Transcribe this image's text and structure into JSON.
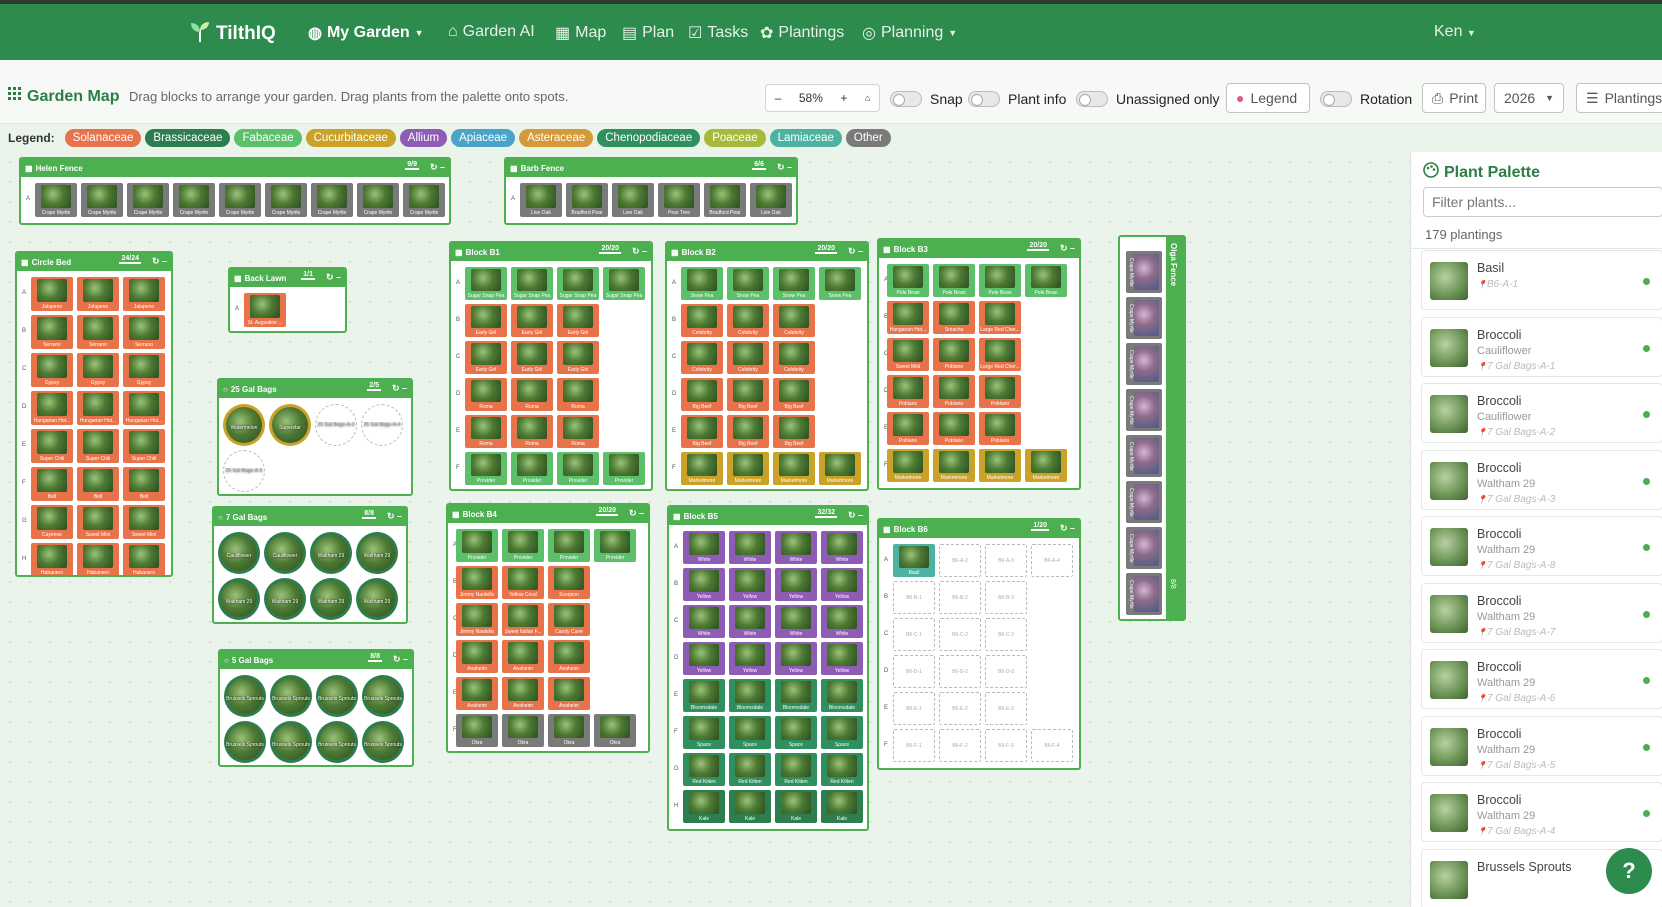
{
  "app": {
    "brand": "TilthIQ",
    "brand_icon": "sprout-icon"
  },
  "nav": {
    "items": [
      {
        "label": "My Garden",
        "icon": "globe-icon",
        "dropdown": true
      },
      {
        "label": "Garden AI",
        "icon": "robot-icon"
      },
      {
        "label": "Map",
        "icon": "map-icon"
      },
      {
        "label": "Plan",
        "icon": "plan-icon"
      },
      {
        "label": "Tasks",
        "icon": "check-icon"
      },
      {
        "label": "Plantings",
        "icon": "flower-icon"
      },
      {
        "label": "Planning",
        "icon": "compass-icon",
        "dropdown": true
      }
    ],
    "user": "Ken"
  },
  "toolbar": {
    "title": "Garden Map",
    "description": "Drag blocks to arrange your garden. Drag plants from the palette onto spots.",
    "zoom": "58%",
    "toggles": [
      {
        "label": "Snap",
        "on": false
      },
      {
        "label": "Plant info",
        "on": false
      },
      {
        "label": "Unassigned only",
        "on": false
      }
    ],
    "legend_button": "Legend",
    "rotation_label": "Rotation",
    "print_button": "Print",
    "year": "2026",
    "plantings_button": "Plantings"
  },
  "legend": {
    "label": "Legend:",
    "families": [
      {
        "name": "Solanaceae",
        "color": "#e8734a"
      },
      {
        "name": "Brassicaceae",
        "color": "#2e7d4f"
      },
      {
        "name": "Fabaceae",
        "color": "#5cbf6a"
      },
      {
        "name": "Cucurbitaceae",
        "color": "#c9a227"
      },
      {
        "name": "Allium",
        "color": "#8e5bb5"
      },
      {
        "name": "Apiaceae",
        "color": "#4aa3c8"
      },
      {
        "name": "Asteraceae",
        "color": "#d49a3a"
      },
      {
        "name": "Chenopodiaceae",
        "color": "#2f8f5e"
      },
      {
        "name": "Poaceae",
        "color": "#a8b83a"
      },
      {
        "name": "Lamiaceae",
        "color": "#4db3a0"
      },
      {
        "name": "Other",
        "color": "#7a7a7a"
      }
    ]
  },
  "blocks": [
    {
      "id": "helen",
      "name": "Helen Fence",
      "count": "9/9",
      "rows": [
        {
          "label": "A",
          "cells": [
            "Crape Myrtle",
            "Crape Myrtle",
            "Crape Myrtle",
            "Crape Myrtle",
            "Crape Myrtle",
            "Crape Myrtle",
            "Crape Myrtle",
            "Crape Myrtle",
            "Crape Myrtle"
          ],
          "fam": "Other"
        }
      ]
    },
    {
      "id": "barb",
      "name": "Barb Fence",
      "count": "6/6",
      "rows": [
        {
          "label": "A",
          "cells": [
            "Live Oak",
            "Bradford Pear",
            "Live Oak",
            "Pear Tree",
            "Bradford Pear",
            "Live Oak"
          ],
          "fam": "Other"
        }
      ]
    },
    {
      "id": "circle",
      "name": "Circle Bed",
      "count": "24/24",
      "rows": [
        {
          "label": "A",
          "cells": [
            "Jalapeno",
            "Jalapeno",
            "Jalapeno"
          ],
          "fam": "Solanaceae"
        },
        {
          "label": "B",
          "cells": [
            "Serrano",
            "Serrano",
            "Serrano"
          ],
          "fam": "Solanaceae"
        },
        {
          "label": "C",
          "cells": [
            "Gypsy",
            "Gypsy",
            "Gypsy"
          ],
          "fam": "Solanaceae"
        },
        {
          "label": "D",
          "cells": [
            "Hungarian Hot...",
            "Hungarian Hot...",
            "Hungarian Hot..."
          ],
          "fam": "Solanaceae"
        },
        {
          "label": "E",
          "cells": [
            "Super Chili",
            "Super Chili",
            "Super Chili"
          ],
          "fam": "Solanaceae"
        },
        {
          "label": "F",
          "cells": [
            "Bell",
            "Bell",
            "Bell"
          ],
          "fam": "Solanaceae"
        },
        {
          "label": "G",
          "cells": [
            "Cayenne",
            "Sweet Mini",
            "Sweet Mini"
          ],
          "fam": "Solanaceae"
        },
        {
          "label": "H",
          "cells": [
            "Habanero",
            "Habanero",
            "Habanero"
          ],
          "fam": "Solanaceae"
        }
      ]
    },
    {
      "id": "backlawn",
      "name": "Back Lawn",
      "count": "1/1",
      "rows": [
        {
          "label": "A",
          "cells": [
            "St. Augustine ..."
          ],
          "fam": "Solanaceae"
        }
      ]
    },
    {
      "id": "g25",
      "name": "25 Gal Bags",
      "count": "2/5",
      "round": true,
      "rows": [
        {
          "label": "",
          "cells": [
            "Watermelon",
            "Superstar",
            "25 Gal Bags-A-3",
            "25 Gal Bags-A-4"
          ],
          "fam": "Cucurbitaceae",
          "empty_from": 2
        },
        {
          "label": "",
          "cells": [
            "25 Gal Bags-A-5"
          ],
          "fam": "Cucurbitaceae",
          "empty_from": 0
        }
      ]
    },
    {
      "id": "g7",
      "name": "7 Gal Bags",
      "count": "8/8",
      "round": true,
      "rows": [
        {
          "label": "",
          "cells": [
            "Cauliflower",
            "Cauliflower",
            "Waltham 29",
            "Waltham 29"
          ],
          "fam": "Brassicaceae"
        },
        {
          "label": "",
          "cells": [
            "Waltham 29",
            "Waltham 29",
            "Waltham 29",
            "Waltham 29"
          ],
          "fam": "Brassicaceae"
        }
      ]
    },
    {
      "id": "g5",
      "name": "5 Gal Bags",
      "count": "8/8",
      "round": true,
      "rows": [
        {
          "label": "",
          "cells": [
            "Brussels Sprouts",
            "Brussels Sprouts",
            "Brussels Sprouts",
            "Brussels Sprouts"
          ],
          "fam": "Brassicaceae"
        },
        {
          "label": "",
          "cells": [
            "Brussels Sprouts",
            "Brussels Sprouts",
            "Brussels Sprouts",
            "Brussels Sprouts"
          ],
          "fam": "Brassicaceae"
        }
      ]
    },
    {
      "id": "b1",
      "name": "Block B1",
      "count": "20/20",
      "rows": [
        {
          "label": "A",
          "cells": [
            "Sugar Snap Pea",
            "Sugar Snap Pea",
            "Sugar Snap Pea",
            "Sugar Snap Pea"
          ],
          "fam": "Fabaceae"
        },
        {
          "label": "B",
          "cells": [
            "Early Girl",
            "Early Girl",
            "Early Girl"
          ],
          "fam": "Solanaceae"
        },
        {
          "label": "C",
          "cells": [
            "Early Girl",
            "Early Girl",
            "Early Girl"
          ],
          "fam": "Solanaceae"
        },
        {
          "label": "D",
          "cells": [
            "Roma",
            "Roma",
            "Roma"
          ],
          "fam": "Solanaceae"
        },
        {
          "label": "E",
          "cells": [
            "Roma",
            "Roma",
            "Roma"
          ],
          "fam": "Solanaceae"
        },
        {
          "label": "F",
          "cells": [
            "Provider",
            "Provider",
            "Provider",
            "Provider"
          ],
          "fam": "Fabaceae"
        }
      ]
    },
    {
      "id": "b2",
      "name": "Block B2",
      "count": "20/20",
      "rows": [
        {
          "label": "A",
          "cells": [
            "Snow Pea",
            "Snow Pea",
            "Snow Pea",
            "Snow Pea"
          ],
          "fam": "Fabaceae"
        },
        {
          "label": "B",
          "cells": [
            "Celebrity",
            "Celebrity",
            "Celebrity"
          ],
          "fam": "Solanaceae"
        },
        {
          "label": "C",
          "cells": [
            "Celebrity",
            "Celebrity",
            "Celebrity"
          ],
          "fam": "Solanaceae"
        },
        {
          "label": "D",
          "cells": [
            "Big Beef",
            "Big Beef",
            "Big Beef"
          ],
          "fam": "Solanaceae"
        },
        {
          "label": "E",
          "cells": [
            "Big Beef",
            "Big Beef",
            "Big Beef"
          ],
          "fam": "Solanaceae"
        },
        {
          "label": "F",
          "cells": [
            "Marketmore",
            "Marketmore",
            "Marketmore",
            "Marketmore"
          ],
          "fam": "Cucurbitaceae"
        }
      ]
    },
    {
      "id": "b3",
      "name": "Block B3",
      "count": "20/20",
      "rows": [
        {
          "label": "A",
          "cells": [
            "Pole Bean",
            "Pole Bean",
            "Pole Bean",
            "Pole Bean"
          ],
          "fam": "Fabaceae"
        },
        {
          "label": "B",
          "cells": [
            "Hungarian Hot...",
            "Sriracha",
            "Large Red Cher..."
          ],
          "fam": "Solanaceae"
        },
        {
          "label": "C",
          "cells": [
            "Sweet Mild",
            "Poblano",
            "Large Red Cher..."
          ],
          "fam": "Solanaceae"
        },
        {
          "label": "D",
          "cells": [
            "Poblano",
            "Poblano",
            "Poblano"
          ],
          "fam": "Solanaceae"
        },
        {
          "label": "E",
          "cells": [
            "Poblano",
            "Poblano",
            "Poblano"
          ],
          "fam": "Solanaceae"
        },
        {
          "label": "F",
          "cells": [
            "Marketmore",
            "Marketmore",
            "Marketmore",
            "Marketmore"
          ],
          "fam": "Cucurbitaceae"
        }
      ]
    },
    {
      "id": "b4",
      "name": "Block B4",
      "count": "20/20",
      "rows": [
        {
          "label": "A",
          "cells": [
            "Provider",
            "Provider",
            "Provider",
            "Provider"
          ],
          "fam": "Fabaceae"
        },
        {
          "label": "B",
          "cells": [
            "Jimmy Nardello",
            "Yellow Coral",
            "Scorpion"
          ],
          "fam": "Solanaceae"
        },
        {
          "label": "C",
          "cells": [
            "Jimmy Nardello",
            "Sweet Italian F...",
            "Candy Cane"
          ],
          "fam": "Solanaceae"
        },
        {
          "label": "D",
          "cells": [
            "Anaheim",
            "Anaheim",
            "Anaheim"
          ],
          "fam": "Solanaceae"
        },
        {
          "label": "E",
          "cells": [
            "Anaheim",
            "Anaheim",
            "Anaheim"
          ],
          "fam": "Solanaceae"
        },
        {
          "label": "F",
          "cells": [
            "Okra",
            "Okra",
            "Okra",
            "Okra"
          ],
          "fam": "Other"
        }
      ]
    },
    {
      "id": "b5",
      "name": "Block B5",
      "count": "32/32",
      "rows": [
        {
          "label": "A",
          "cells": [
            "White",
            "White",
            "White",
            "White"
          ],
          "fam": "Allium"
        },
        {
          "label": "B",
          "cells": [
            "Yellow",
            "Yellow",
            "Yellow",
            "Yellow"
          ],
          "fam": "Allium"
        },
        {
          "label": "C",
          "cells": [
            "White",
            "White",
            "White",
            "White"
          ],
          "fam": "Allium"
        },
        {
          "label": "D",
          "cells": [
            "Yellow",
            "Yellow",
            "Yellow",
            "Yellow"
          ],
          "fam": "Allium"
        },
        {
          "label": "E",
          "cells": [
            "Bloomsdale",
            "Bloomsdale",
            "Bloomsdale",
            "Bloomsdale"
          ],
          "fam": "Chenopodiaceae"
        },
        {
          "label": "F",
          "cells": [
            "Space",
            "Space",
            "Space",
            "Space"
          ],
          "fam": "Chenopodiaceae"
        },
        {
          "label": "G",
          "cells": [
            "Red Kitten",
            "Red Kitten",
            "Red Kitten",
            "Red Kitten"
          ],
          "fam": "Chenopodiaceae"
        },
        {
          "label": "H",
          "cells": [
            "Kale",
            "Kale",
            "Kale",
            "Kale"
          ],
          "fam": "Brassicaceae"
        }
      ]
    },
    {
      "id": "b6",
      "name": "Block B6",
      "count": "1/20",
      "rows": [
        {
          "label": "A",
          "cells": [
            "Basil",
            "B6-A-2",
            "B6-A-3",
            "B6-A-4"
          ],
          "fam": "Lamiaceae",
          "empty_from": 1
        },
        {
          "label": "B",
          "cells": [
            "B6-B-1",
            "B6-B-2",
            "B6-B-3"
          ],
          "fam": "Other",
          "empty_from": 0
        },
        {
          "label": "C",
          "cells": [
            "B6-C-1",
            "B6-C-2",
            "B6-C-3"
          ],
          "fam": "Other",
          "empty_from": 0
        },
        {
          "label": "D",
          "cells": [
            "B6-D-1",
            "B6-D-2",
            "B6-D-3"
          ],
          "fam": "Other",
          "empty_from": 0
        },
        {
          "label": "E",
          "cells": [
            "B6-E-1",
            "B6-E-2",
            "B6-E-3"
          ],
          "fam": "Other",
          "empty_from": 0
        },
        {
          "label": "F",
          "cells": [
            "B6-F-1",
            "B6-F-2",
            "B6-F-3",
            "B6-F-4"
          ],
          "fam": "Other",
          "empty_from": 0
        }
      ]
    },
    {
      "id": "olga",
      "name": "Olga Fence",
      "count": "8/8",
      "vertical": true,
      "rows": [
        {
          "label": "A",
          "cells": [
            "Crape Myrtle",
            "Crape Myrtle",
            "Crape Myrtle",
            "Crape Myrtle",
            "Crape Myrtle",
            "Crape Myrtle",
            "Crape Myrtle",
            "Crape Myrtle"
          ],
          "fam": "Other"
        }
      ]
    }
  ],
  "palette": {
    "title": "Plant Palette",
    "filter_placeholder": "Filter plants...",
    "count": "179 plantings",
    "items": [
      {
        "name": "Basil",
        "variety": "",
        "location": "B6-A-1"
      },
      {
        "name": "Broccoli",
        "variety": "Cauliflower",
        "location": "7 Gal Bags-A-1"
      },
      {
        "name": "Broccoli",
        "variety": "Cauliflower",
        "location": "7 Gal Bags-A-2"
      },
      {
        "name": "Broccoli",
        "variety": "Waltham 29",
        "location": "7 Gal Bags-A-3"
      },
      {
        "name": "Broccoli",
        "variety": "Waltham 29",
        "location": "7 Gal Bags-A-8"
      },
      {
        "name": "Broccoli",
        "variety": "Waltham 29",
        "location": "7 Gal Bags-A-7"
      },
      {
        "name": "Broccoli",
        "variety": "Waltham 29",
        "location": "7 Gal Bags-A-6"
      },
      {
        "name": "Broccoli",
        "variety": "Waltham 29",
        "location": "7 Gal Bags-A-5"
      },
      {
        "name": "Broccoli",
        "variety": "Waltham 29",
        "location": "7 Gal Bags-A-4"
      },
      {
        "name": "Brussels Sprouts",
        "variety": "",
        "location": ""
      }
    ]
  },
  "help_label": "?"
}
